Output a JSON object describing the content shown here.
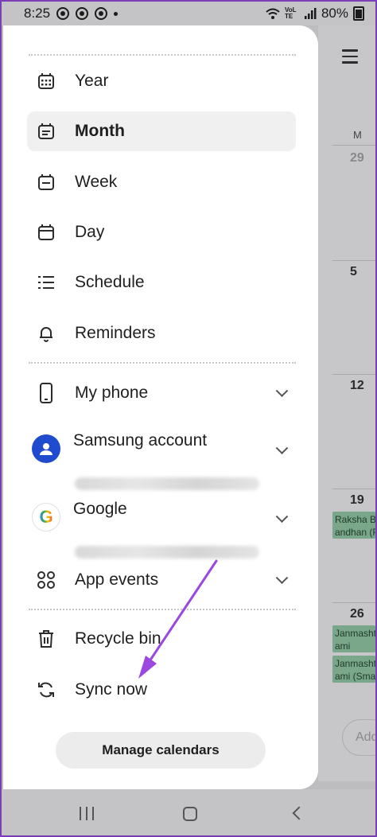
{
  "status_bar": {
    "time": "8:25",
    "volte": "VoLTE",
    "battery": "80%"
  },
  "drawer": {
    "views": [
      {
        "label": "Year",
        "icon": "calendar-grid-icon"
      },
      {
        "label": "Month",
        "icon": "calendar-month-icon",
        "selected": true
      },
      {
        "label": "Week",
        "icon": "calendar-week-icon"
      },
      {
        "label": "Day",
        "icon": "calendar-day-icon"
      },
      {
        "label": "Schedule",
        "icon": "list-icon"
      },
      {
        "label": "Reminders",
        "icon": "bell-icon"
      }
    ],
    "accounts": [
      {
        "label": "My phone",
        "icon": "phone-icon"
      },
      {
        "label": "Samsung account",
        "icon": "samsung-account-icon"
      },
      {
        "label": "Google",
        "icon": "google-icon"
      },
      {
        "label": "App events",
        "icon": "app-grid-icon"
      }
    ],
    "tools": [
      {
        "label": "Recycle bin",
        "icon": "trash-icon"
      },
      {
        "label": "Sync now",
        "icon": "sync-icon"
      }
    ],
    "manage_button": "Manage calendars",
    "google_glyph": "G"
  },
  "background_calendar": {
    "weekday_header": "M",
    "dates": [
      "29",
      "5",
      "12",
      "19",
      "26"
    ],
    "events": [
      "Raksha B\nandhan (F",
      "Janmasht\nami",
      "Janmasht\nami (Sma"
    ],
    "add_label": "Add"
  },
  "colors": {
    "annotation_arrow": "#9b47e0",
    "event_green": "#7aa68a",
    "samsung_blue": "#1f4ccf"
  }
}
